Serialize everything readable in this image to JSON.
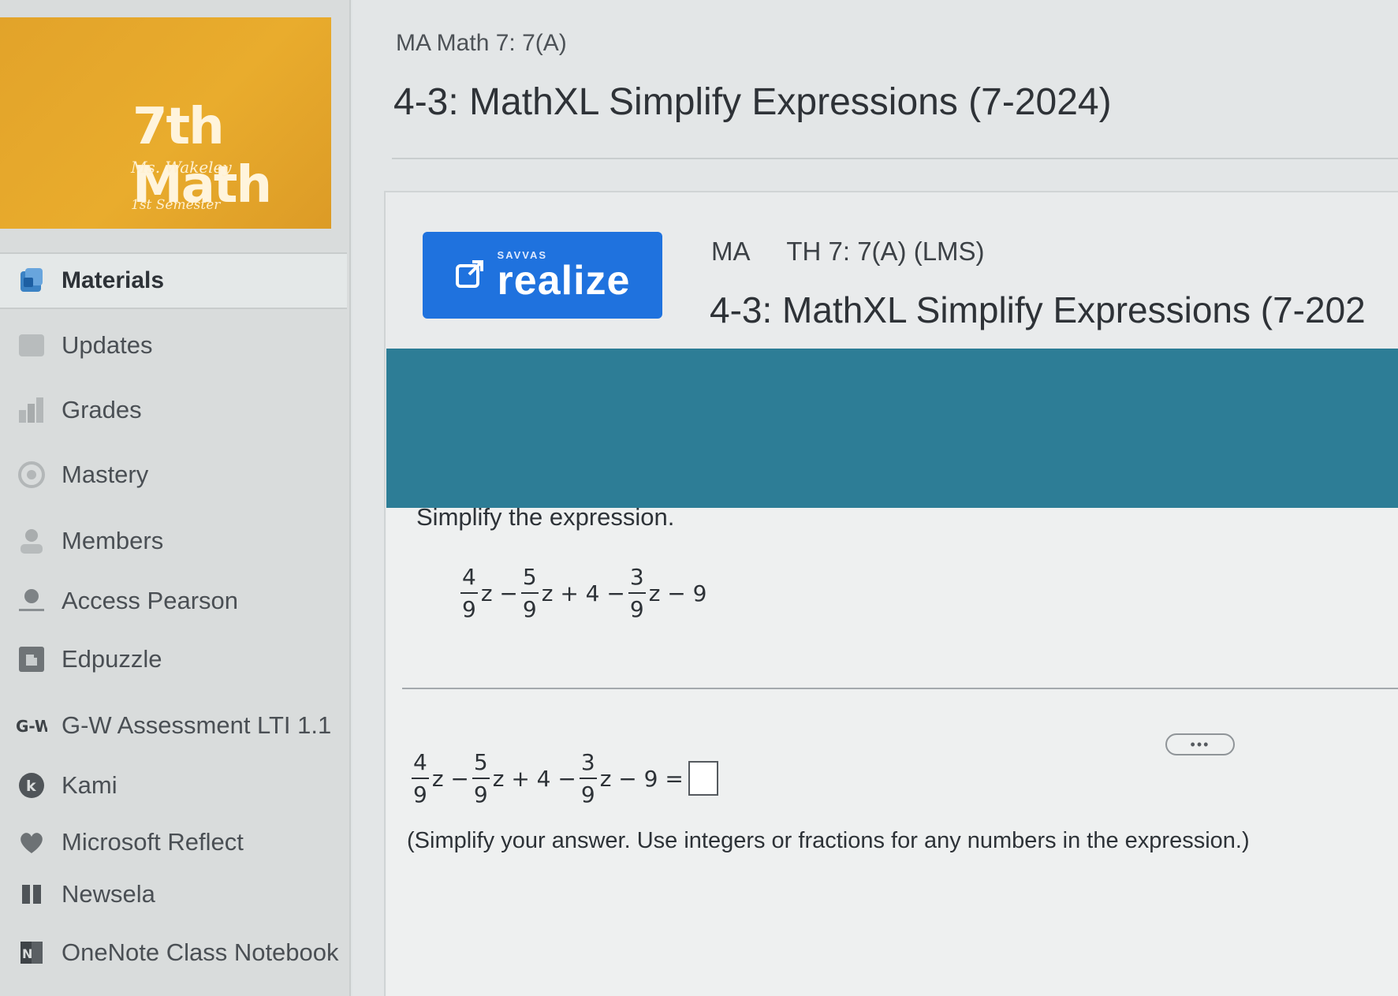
{
  "course_banner": {
    "title": "7th Math",
    "teacher": "Ms. Wakeley",
    "semester": "1st Semester"
  },
  "sidebar": {
    "items": [
      {
        "label": "Materials",
        "icon": "materials-icon"
      },
      {
        "label": "Updates",
        "icon": "updates-icon"
      },
      {
        "label": "Grades",
        "icon": "grades-icon"
      },
      {
        "label": "Mastery",
        "icon": "mastery-icon"
      },
      {
        "label": "Members",
        "icon": "members-icon"
      },
      {
        "label": "Access Pearson",
        "icon": "pearson-icon"
      },
      {
        "label": "Edpuzzle",
        "icon": "edpuzzle-icon"
      },
      {
        "label": "G-W Assessment LTI 1.1",
        "icon": "gw-icon"
      },
      {
        "label": "Kami",
        "icon": "kami-icon"
      },
      {
        "label": "Microsoft Reflect",
        "icon": "reflect-icon"
      },
      {
        "label": "Newsela",
        "icon": "newsela-icon"
      },
      {
        "label": "OneNote Class Notebook",
        "icon": "onenote-icon"
      }
    ],
    "active_index": 0
  },
  "main": {
    "breadcrumb": "MA Math 7: 7(A)",
    "title": "4-3: MathXL Simplify Expressions (7-2024)"
  },
  "realize": {
    "brand": "SAVVAS",
    "word": "realize",
    "subtitle": "MA     TH 7: 7(A) (LMS)",
    "title": "4-3: MathXL Simplify Expressions (7-202"
  },
  "question": {
    "prompt": "Simplify the expression.",
    "expr": {
      "t1_num": "4",
      "t1_den": "9",
      "op1": "z −",
      "t2_num": "5",
      "t2_den": "9",
      "op2": "z + 4 −",
      "t3_num": "3",
      "t3_den": "9",
      "op3": "z − 9"
    },
    "answer_suffix": "z − 9 =",
    "more_label": "•••",
    "instruction": "(Simplify your answer. Use integers or fractions for any numbers in the expression.)"
  },
  "colors": {
    "banner": "#e9ac2d",
    "realize_blue": "#1f72de",
    "teal_band": "#2d7d96"
  }
}
